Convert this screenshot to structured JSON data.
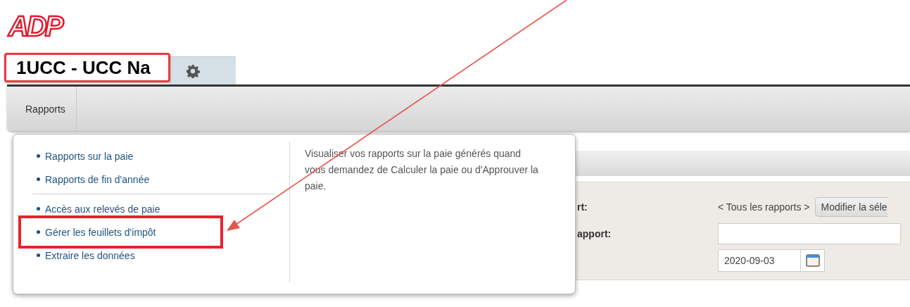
{
  "logo": "ADP",
  "company_tab": {
    "label": "1UCC - UCC Na",
    "selected": true
  },
  "menu_bar": {
    "items": [
      {
        "label": "Rapports",
        "selected": true
      }
    ]
  },
  "dropdown": {
    "groups": [
      [
        "Rapports sur la paie",
        "Rapports de fin d'année"
      ],
      [
        "Accès aux relevés de paie",
        "Gérer les feuillets d'impôt",
        "Extraire les données"
      ]
    ],
    "description": "Visualiser vos rapports sur la paie générés quand vous demandez de Calculer la paie ou d'Approuver la paie."
  },
  "form": {
    "rows": [
      {
        "kind": "links",
        "label": "rt:",
        "value": "< Tous les rapports >",
        "button": "Modifier la séle"
      },
      {
        "kind": "text_input",
        "label": "apport:"
      },
      {
        "kind": "date",
        "value": "2020-09-03"
      }
    ]
  }
}
